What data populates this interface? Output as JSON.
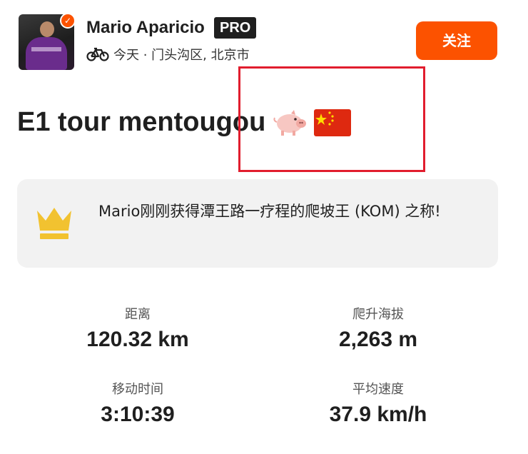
{
  "athlete": {
    "name": "Mario Aparicio",
    "pro_badge": "PRO",
    "activity_meta": "今天 · 门头沟区, 北京市"
  },
  "follow_button": {
    "label": "关注"
  },
  "activity": {
    "title": "E1 tour mentougou"
  },
  "achievement": {
    "text": "Mario刚刚获得潭王路一疗程的爬坡王 (KOM) 之称!"
  },
  "stats": [
    {
      "label": "距离",
      "value": "120.32 km"
    },
    {
      "label": "爬升海拔",
      "value": "2,263 m"
    },
    {
      "label": "移动时间",
      "value": "3:10:39"
    },
    {
      "label": "平均速度",
      "value": "37.9 km/h"
    }
  ],
  "colors": {
    "accent": "#fc5200",
    "highlight_box": "#e11d2e",
    "card_bg": "#f2f2f2",
    "crown": "#f2c230"
  },
  "icons": {
    "bike": "bike-icon",
    "crown": "crown-icon",
    "pig": "pig-emoji-icon",
    "flag": "china-flag-icon",
    "verified": "verified-badge-icon"
  }
}
